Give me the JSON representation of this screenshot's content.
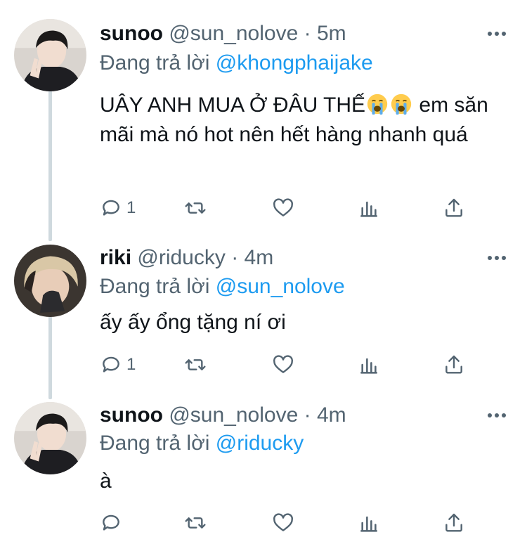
{
  "replies": [
    {
      "name": "sunoo",
      "handle": "@sun_nolove",
      "separator": "·",
      "time": "5m",
      "replying_prefix": "Đang trả lời",
      "replying_to": "@khongphaijake",
      "text_before_emoji": "UÂY ANH MUA Ở ĐÂU THẾ",
      "emoji": [
        "loudly-crying-face",
        "loudly-crying-face"
      ],
      "text_after_emoji": " em săn mãi mà nó hot nên hết hàng nhanh quá",
      "reply_count": "1"
    },
    {
      "name": "riki",
      "handle": "@riducky",
      "separator": "·",
      "time": "4m",
      "replying_prefix": "Đang trả lời",
      "replying_to": "@sun_nolove",
      "text": "ấy ấy ổng tặng ní ơi",
      "reply_count": "1"
    },
    {
      "name": "sunoo",
      "handle": "@sun_nolove",
      "separator": "·",
      "time": "4m",
      "replying_prefix": "Đang trả lời",
      "replying_to": "@riducky",
      "text": "à",
      "reply_count": ""
    }
  ],
  "icons": [
    "reply-icon",
    "retweet-icon",
    "like-icon",
    "analytics-icon",
    "share-icon",
    "more-icon"
  ],
  "colors": {
    "link": "#1d9bf0",
    "secondary": "#536471",
    "thread_line": "#cfd9de"
  }
}
